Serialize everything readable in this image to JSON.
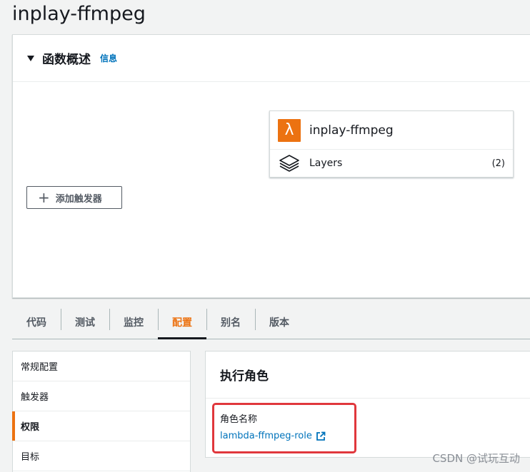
{
  "page_title": "inplay-ffmpeg",
  "overview": {
    "title": "函数概述",
    "info_link": "信息",
    "function_name": "inplay-ffmpeg",
    "layers_label": "Layers",
    "layers_count": "(2)",
    "add_trigger_label": "添加触发器"
  },
  "tabs": [
    {
      "label": "代码"
    },
    {
      "label": "测试"
    },
    {
      "label": "监控"
    },
    {
      "label": "配置",
      "active": true
    },
    {
      "label": "别名"
    },
    {
      "label": "版本"
    }
  ],
  "side_nav": [
    {
      "label": "常规配置"
    },
    {
      "label": "触发器"
    },
    {
      "label": "权限",
      "active": true
    },
    {
      "label": "目标"
    }
  ],
  "role_panel": {
    "title": "执行角色",
    "field_label": "角色名称",
    "role_name": "lambda-ffmpeg-role"
  },
  "watermark": "CSDN @试玩互动",
  "colors": {
    "accent": "#ec7211",
    "link": "#0073bb",
    "highlight": "#e0373c"
  },
  "icons": {
    "lambda": "lambda-icon",
    "layers": "layers-icon",
    "external": "external-link-icon",
    "plus": "plus-icon",
    "caret": "caret-down-icon"
  }
}
